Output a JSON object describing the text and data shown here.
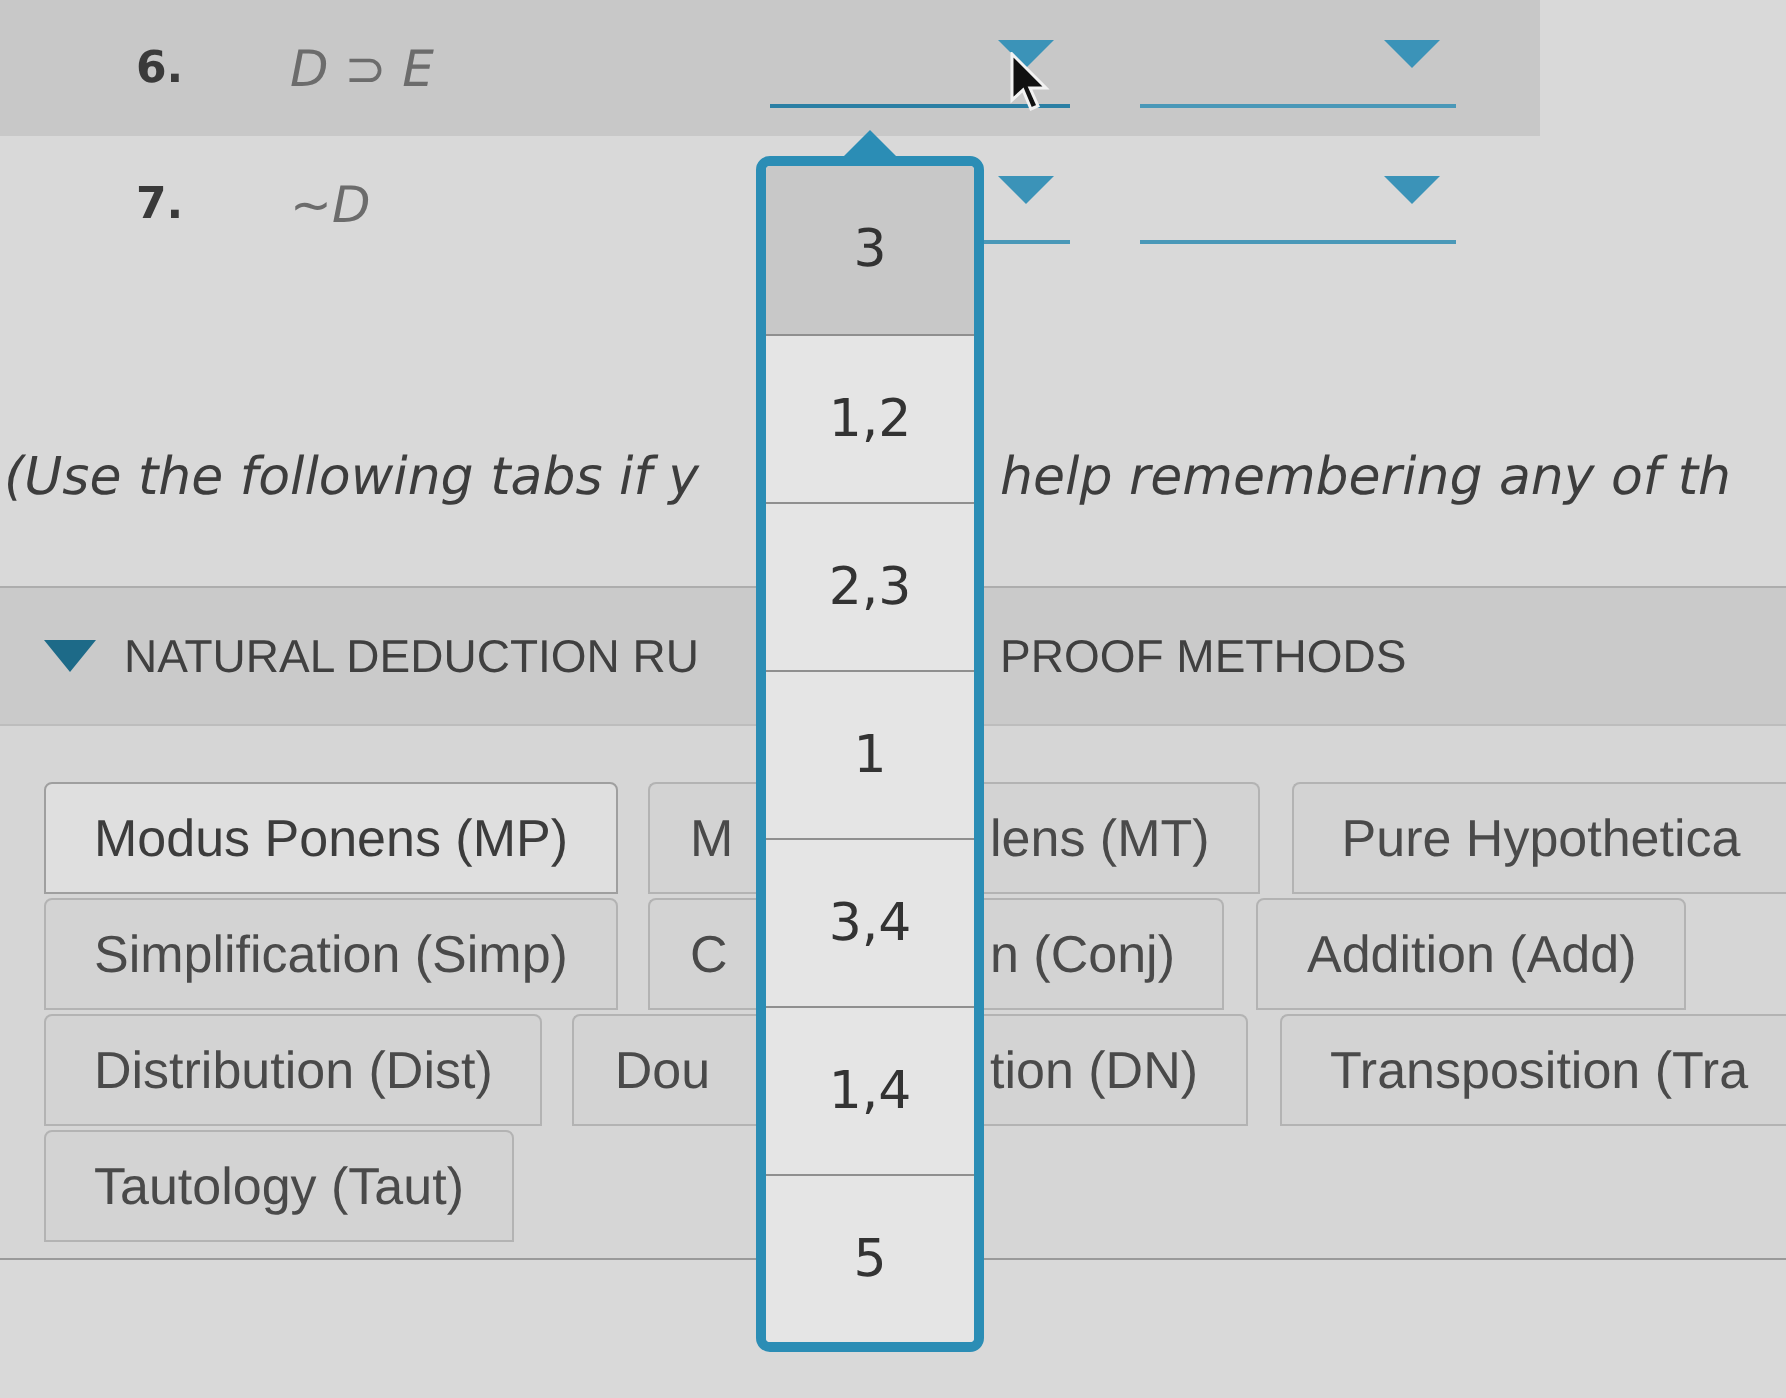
{
  "proof_lines": [
    {
      "number": "6.",
      "formula": "D ⊃ E",
      "hovered": true,
      "dropdowns": [
        {
          "open": true,
          "options": [
            {
              "label": "3",
              "selected": true
            },
            {
              "label": "1,2",
              "selected": false
            },
            {
              "label": "2,3",
              "selected": false
            },
            {
              "label": "1",
              "selected": false
            },
            {
              "label": "3,4",
              "selected": false
            },
            {
              "label": "1,4",
              "selected": false
            },
            {
              "label": "5",
              "selected": false
            }
          ]
        },
        {
          "open": false
        }
      ]
    },
    {
      "number": "7.",
      "formula": "~D",
      "hovered": false,
      "dropdowns": [
        {
          "open": false
        },
        {
          "open": false
        }
      ]
    }
  ],
  "instructions": {
    "text_before_menu": "(Use the following tabs if y",
    "text_after_menu": "help remembering any of th"
  },
  "rules_header": {
    "label": "NATURAL DEDUCTION RU",
    "expanded": true
  },
  "proof_methods_header": {
    "label": "PROOF METHODS"
  },
  "rule_tab_rows": [
    {
      "tabs": [
        {
          "label": "Modus Ponens (MP)",
          "kind": "whole",
          "selected": true
        },
        {
          "label": "M",
          "kind": "covered_end",
          "selected": false
        },
        {
          "label": "lens (MT)",
          "kind": "covered_start",
          "selected": false
        },
        {
          "label": "Pure Hypothetica",
          "kind": "clipped_end",
          "selected": false
        }
      ]
    },
    {
      "tabs": [
        {
          "label": "Simplification (Simp)",
          "kind": "whole",
          "selected": false
        },
        {
          "label": "C",
          "kind": "covered_end",
          "selected": false
        },
        {
          "label": "n (Conj)",
          "kind": "covered_start",
          "selected": false
        },
        {
          "label": "Addition (Add)",
          "kind": "whole",
          "selected": false
        }
      ]
    },
    {
      "tabs": [
        {
          "label": "Distribution (Dist)",
          "kind": "whole",
          "selected": false
        },
        {
          "label": "Dou",
          "kind": "covered_end",
          "selected": false
        },
        {
          "label": "tion (DN)",
          "kind": "covered_start",
          "selected": false
        },
        {
          "label": "Transposition (Tra",
          "kind": "clipped_end",
          "selected": false
        }
      ]
    },
    {
      "tabs": [
        {
          "label": "Tautology (Taut)",
          "kind": "whole",
          "selected": false
        }
      ]
    }
  ]
}
